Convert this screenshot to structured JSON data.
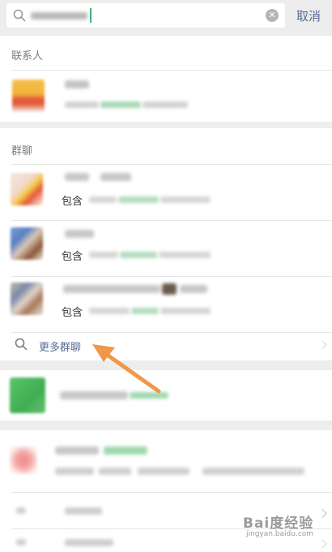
{
  "header": {
    "cancel_label": "取消",
    "search_query_obscured": true
  },
  "contacts": {
    "section_title": "联系人",
    "items": [
      {
        "name_obscured": true,
        "detail_obscured": true
      }
    ]
  },
  "groups": {
    "section_title": "群聊",
    "items": [
      {
        "contains_label": "包含"
      },
      {
        "contains_label": "包含"
      },
      {
        "contains_label": "包含"
      }
    ],
    "more_label": "更多群聊"
  },
  "other_results": {
    "items_obscured": true
  },
  "watermark": {
    "brand": "Bai度经验",
    "url": "jingyan.baidu.com"
  },
  "colors": {
    "link_blue": "#576b95",
    "highlight_green": "#3cb371",
    "arrow_orange": "#f0974a",
    "section_bg": "#ededed"
  }
}
